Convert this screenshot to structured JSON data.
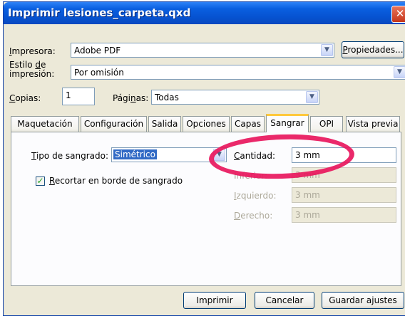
{
  "window": {
    "title": "Imprimir lesiones_carpeta.qxd",
    "close": "✕"
  },
  "printer": {
    "label_first": "I",
    "label_rest": "mpresora:",
    "value": "Adobe PDF",
    "properties_first": "P",
    "properties_rest": "ropiedades..."
  },
  "style": {
    "label_line1_pre": "Estilo ",
    "label_line1_u": "d",
    "label_line1_post": "e",
    "label_line2": "impresión:",
    "value": "Por omisión"
  },
  "copies": {
    "label_first": "C",
    "label_rest": "opias:",
    "value": "1"
  },
  "pages": {
    "label_pre": "Pági",
    "label_u": "n",
    "label_post": "as:",
    "value": "Todas"
  },
  "tabs": [
    "Maquetación",
    "Configuración",
    "Salida",
    "Opciones",
    "Capas",
    "Sangrar",
    "OPI",
    "Vista previa"
  ],
  "bleed": {
    "type_label_first": "T",
    "type_label_rest": "ipo de sangrado:",
    "type_value": "Simétrico",
    "clip_checked": true,
    "clip_label_first": "R",
    "clip_label_rest": "ecortar en borde de sangrado",
    "amount_label_first": "C",
    "amount_label_rest": "antidad:",
    "amount_value": "3 mm",
    "top_label": "Inferior:",
    "top_value": "3 mm",
    "left_label_first": "I",
    "left_label_rest": "zquierdo:",
    "left_value": "3 mm",
    "right_label_first": "D",
    "right_label_rest": "erecho:",
    "right_value": "3 mm"
  },
  "buttons": {
    "print": "Imprimir",
    "cancel": "Cancelar",
    "save": "Guardar ajustes"
  },
  "annotation": {
    "color": "#e8175d"
  },
  "colors": {
    "titlebar": "#0a5fe0",
    "dialog_bg": "#ece9d8",
    "selection": "#316ac5",
    "active_tab_accent": "#ffc83c"
  }
}
